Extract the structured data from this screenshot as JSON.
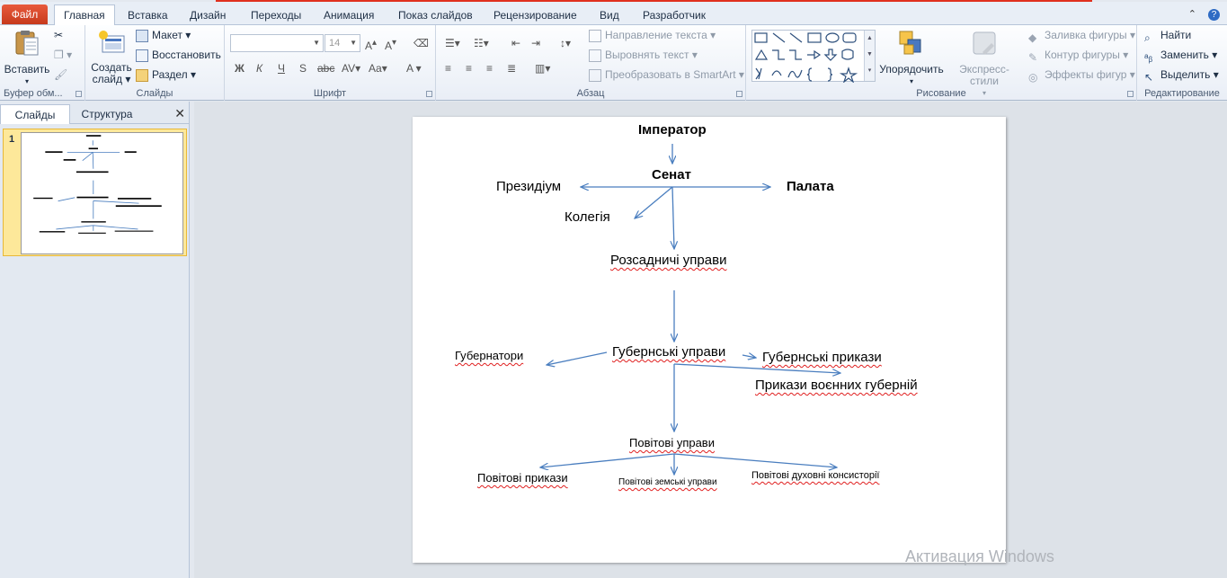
{
  "tabs": {
    "file": "Файл",
    "items": [
      "Главная",
      "Вставка",
      "Дизайн",
      "Переходы",
      "Анимация",
      "Показ слайдов",
      "Рецензирование",
      "Вид",
      "Разработчик"
    ]
  },
  "ribbon": {
    "clipboard": {
      "paste": "Вставить",
      "label": "Буфер обм..."
    },
    "slides": {
      "create": "Создать",
      "create2": "слайд",
      "layout": "Макет",
      "reset": "Восстановить",
      "section": "Раздел",
      "label": "Слайды"
    },
    "font": {
      "size": "14",
      "bold": "Ж",
      "italic": "К",
      "underline": "Ч",
      "shadow": "S",
      "strike": "abc",
      "spacing": "AV",
      "case": "Aa",
      "color": "A",
      "label": "Шрифт"
    },
    "paragraph": {
      "direction": "Направление текста",
      "align": "Выровнять текст",
      "smartart": "Преобразовать в SmartArt",
      "label": "Абзац"
    },
    "drawing": {
      "arrange": "Упорядочить",
      "quick": "Экспресс-стили",
      "fill": "Заливка фигуры",
      "outline": "Контур фигуры",
      "effects": "Эффекты фигур",
      "label": "Рисование"
    },
    "editing": {
      "find": "Найти",
      "replace": "Заменить",
      "select": "Выделить",
      "label": "Редактирование"
    }
  },
  "pane": {
    "slides_tab": "Слайды",
    "outline_tab": "Структура",
    "slide_number": "1"
  },
  "slide": {
    "nodes": {
      "emperor": "Імператор",
      "senate": "Сенат",
      "presidium": "Президіум",
      "chamber": "Палата",
      "collegium": "Колегія",
      "admin": "Розсадничі управи",
      "gub_admin": "Губернські управи",
      "governors": "Губернатори",
      "gub_orders": "Губернські прикази",
      "mil_orders": "Прикази воєнних губерній",
      "pov_admin": "Повітові управи",
      "pov_orders": "Повітові прикази",
      "pov_zemstvo": "Повітові земські управи",
      "pov_consist": "Повітові духовні консисторії"
    }
  },
  "watermark": "Активация Windows"
}
